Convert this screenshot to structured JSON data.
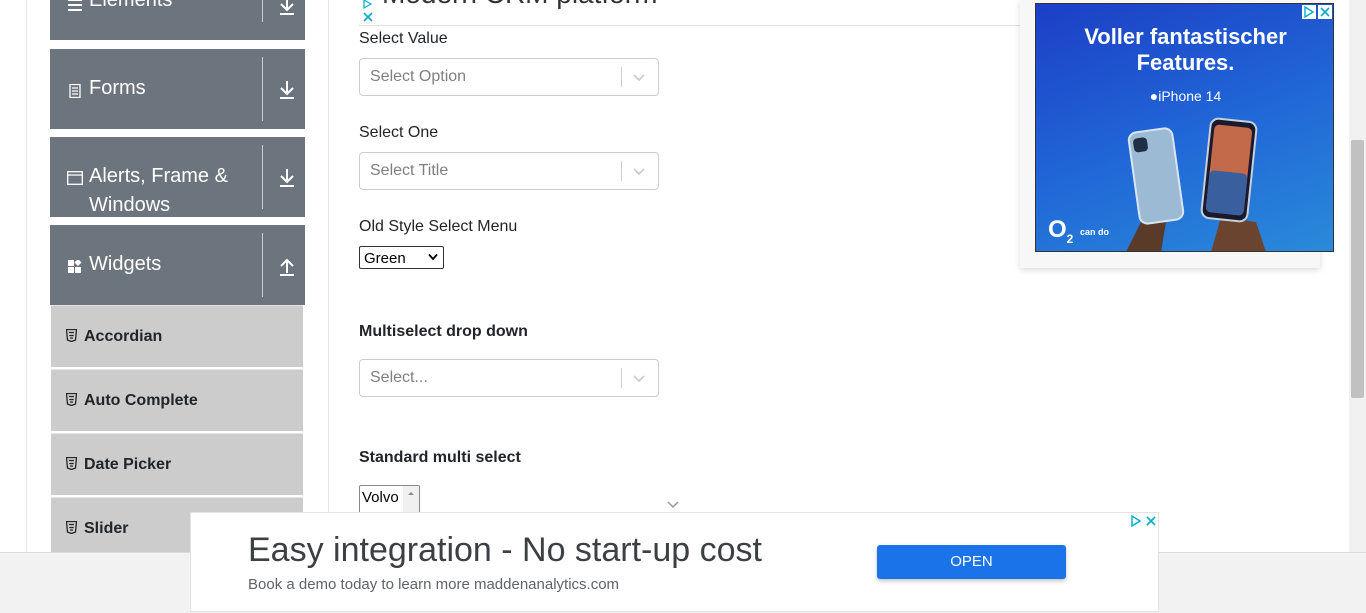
{
  "sidebar": {
    "groups": [
      {
        "label": "Elements",
        "icon": "hamburger-icon",
        "arrow": "download-arrow-icon"
      },
      {
        "label": "Forms",
        "icon": "document-icon",
        "arrow": "download-arrow-icon"
      },
      {
        "label": "Alerts, Frame &",
        "label2": "Windows",
        "icon": "window-icon",
        "arrow": "download-arrow-icon"
      },
      {
        "label": "Widgets",
        "icon": "widgets-icon",
        "arrow": "upload-arrow-icon"
      }
    ],
    "items": [
      {
        "label": "Accordian",
        "icon": "html5-icon"
      },
      {
        "label": "Auto Complete",
        "icon": "html5-icon"
      },
      {
        "label": "Date Picker",
        "icon": "html5-icon"
      },
      {
        "label": "Slider",
        "icon": "html5-icon"
      }
    ]
  },
  "main": {
    "cut_heading": "Modern CRM platform",
    "select_value": {
      "label": "Select Value",
      "placeholder": "Select Option"
    },
    "select_one": {
      "label": "Select One",
      "placeholder": "Select Title"
    },
    "old_style": {
      "label": "Old Style Select Menu",
      "value": "Green"
    },
    "multiselect": {
      "label": "Multiselect drop down",
      "placeholder": "Select..."
    },
    "standard_multi": {
      "label": "Standard multi select",
      "value": "Volvo"
    }
  },
  "ads": {
    "right": {
      "headline_1": "Voller fantastischer",
      "headline_2": "Features.",
      "product": "iPhone 14",
      "logo": "O",
      "logo_sub": "2",
      "tagline": "can do"
    },
    "bottom": {
      "headline": "Easy integration - No start-up cost",
      "subline": "Book a demo today to learn more maddenanalytics.com",
      "button": "OPEN"
    }
  },
  "colors": {
    "sidebar_group_bg": "#6c757d",
    "sidebar_item_bg": "#cccccc",
    "ad_button": "#1a73e8"
  }
}
